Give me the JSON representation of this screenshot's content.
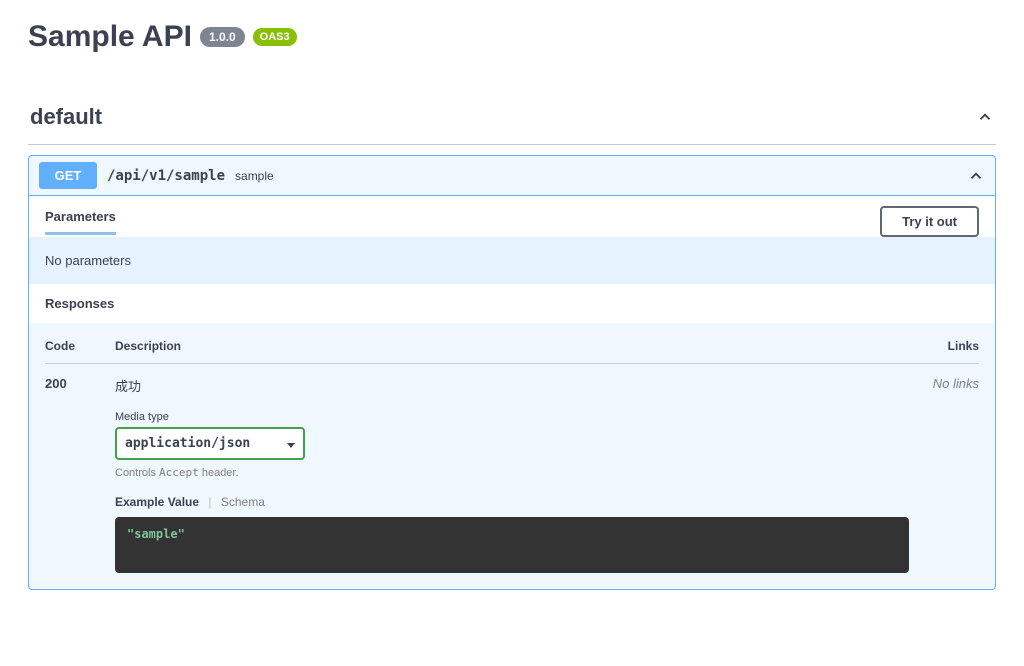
{
  "api": {
    "title": "Sample API",
    "version": "1.0.0",
    "spec_badge": "OAS3"
  },
  "tag": {
    "name": "default"
  },
  "operation": {
    "method": "GET",
    "path": "/api/v1/sample",
    "summary": "sample"
  },
  "sections": {
    "parameters_label": "Parameters",
    "try_it_out": "Try it out",
    "no_parameters": "No parameters",
    "responses_label": "Responses"
  },
  "responses": {
    "headers": {
      "code": "Code",
      "description": "Description",
      "links": "Links"
    },
    "row": {
      "code": "200",
      "description": "成功",
      "links": "No links",
      "media_type_label": "Media type",
      "media_type_value": "application/json",
      "accept_note_prefix": "Controls ",
      "accept_note_kw": "Accept",
      "accept_note_suffix": " header.",
      "tab_example": "Example Value",
      "tab_schema": "Schema",
      "example_body": "\"sample\""
    }
  }
}
